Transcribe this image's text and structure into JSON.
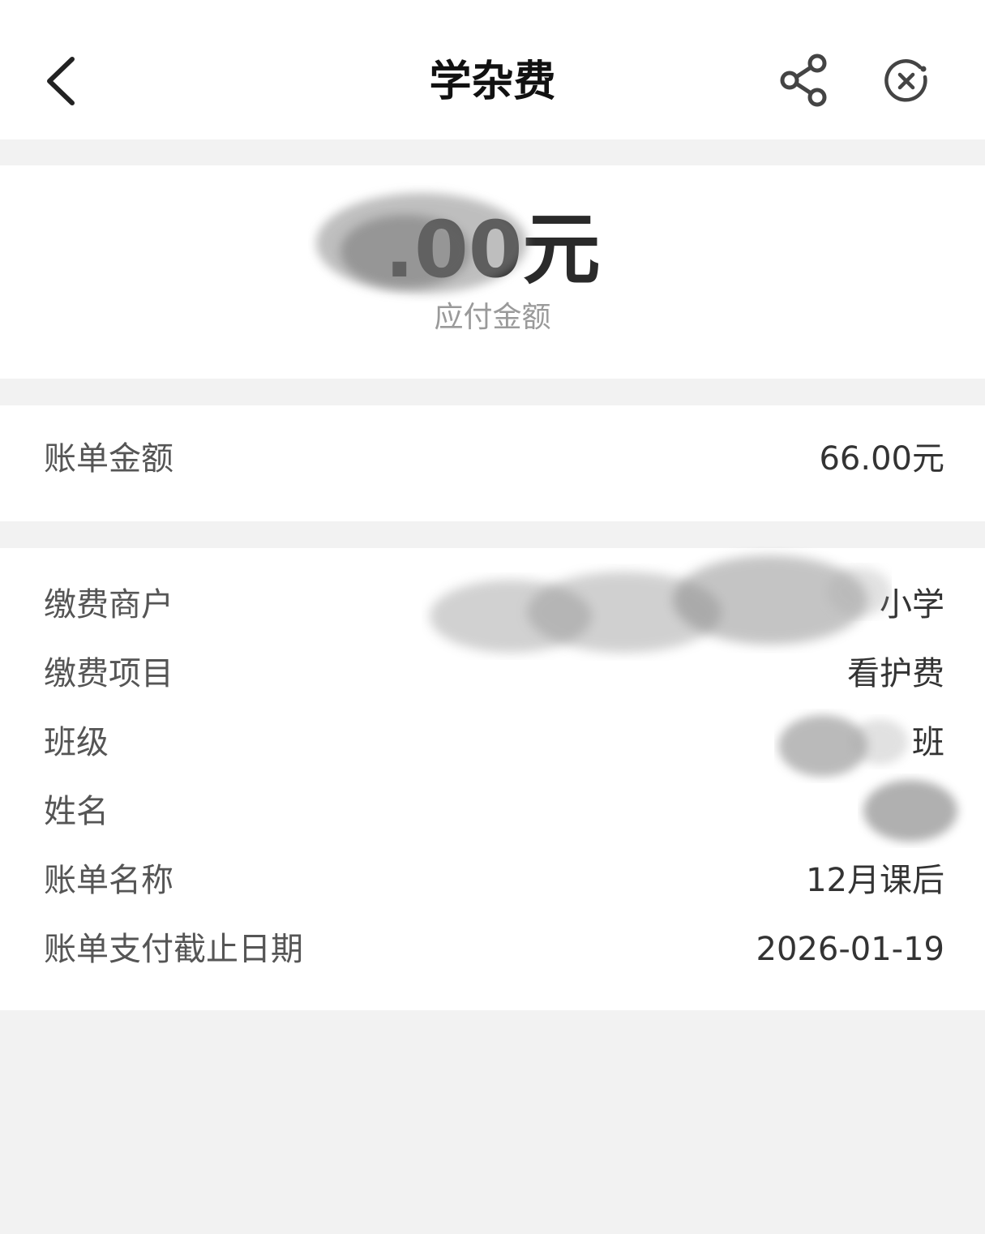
{
  "header": {
    "title": "学杂费",
    "back_icon": "chevron-left-icon",
    "share_icon": "share-icon",
    "close_icon": "close-circle-icon"
  },
  "amount": {
    "value": ".00元",
    "label": "应付金额"
  },
  "bill_amount": {
    "label": "账单金额",
    "value": "66.00元"
  },
  "details": {
    "merchant": {
      "label": "缴费商户",
      "value": "小学"
    },
    "item": {
      "label": "缴费项目",
      "value": "看护费"
    },
    "class": {
      "label": "班级",
      "value": "班"
    },
    "name": {
      "label": "姓名",
      "value": ""
    },
    "bill_name": {
      "label": "账单名称",
      "value": "12月课后"
    },
    "deadline": {
      "label": "账单支付截止日期",
      "value": "2026-01-19"
    }
  },
  "colors": {
    "background": "#f2f2f2",
    "card": "#ffffff",
    "title": "#111111",
    "label": "#555555",
    "muted": "#9a9a9a"
  }
}
